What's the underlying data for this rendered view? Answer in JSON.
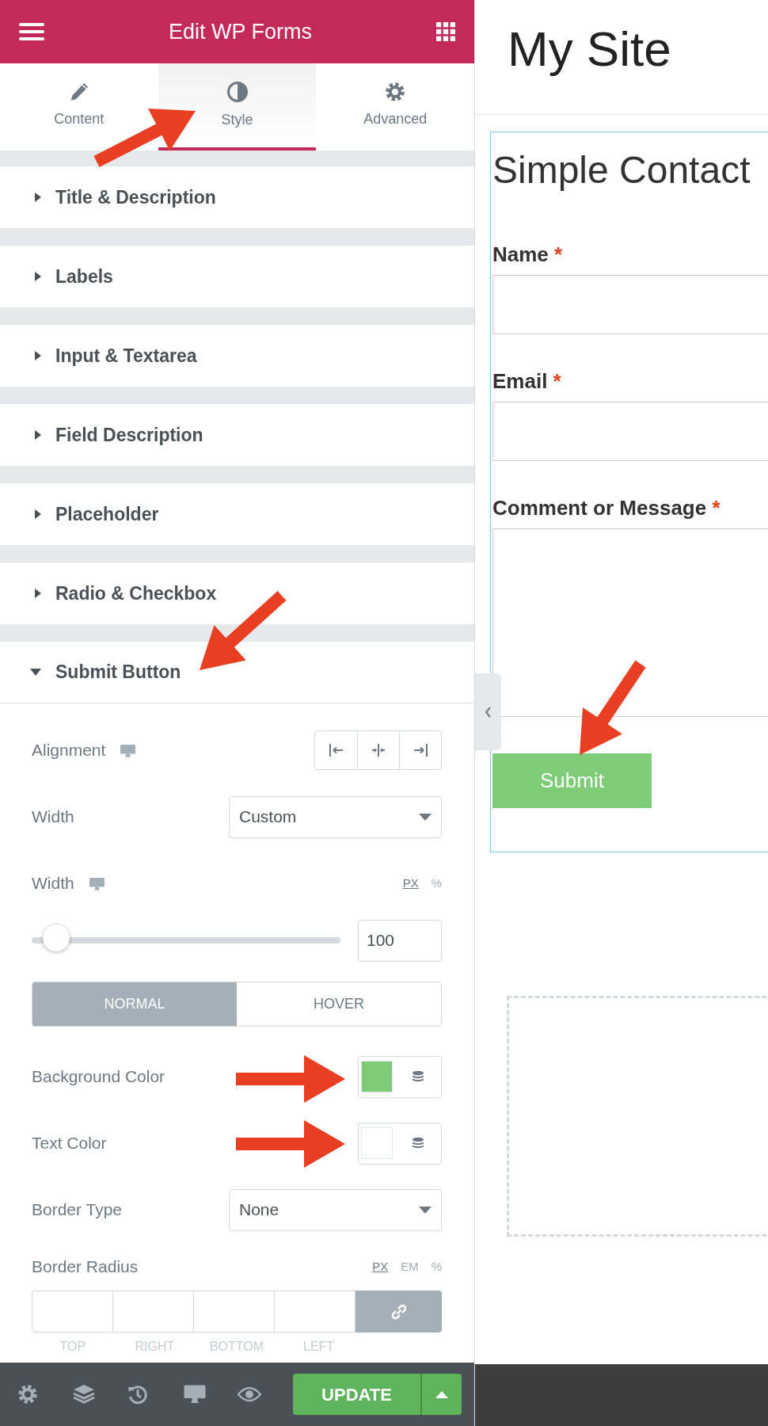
{
  "panel": {
    "title": "Edit WP Forms",
    "tabs": [
      {
        "label": "Content",
        "selected": false
      },
      {
        "label": "Style",
        "selected": true
      },
      {
        "label": "Advanced",
        "selected": false
      }
    ],
    "sections": [
      {
        "title": "Title & Description",
        "expanded": false
      },
      {
        "title": "Labels",
        "expanded": false
      },
      {
        "title": "Input & Textarea",
        "expanded": false
      },
      {
        "title": "Field Description",
        "expanded": false
      },
      {
        "title": "Placeholder",
        "expanded": false
      },
      {
        "title": "Radio & Checkbox",
        "expanded": false
      },
      {
        "title": "Submit Button",
        "expanded": true
      }
    ],
    "controls": [
      {
        "kind": "align",
        "label": "Alignment",
        "responsive": true
      },
      {
        "kind": "select",
        "label": "Width",
        "value": "Custom"
      },
      {
        "kind": "slider",
        "label": "Width",
        "responsive": true,
        "units": [
          {
            "label": "PX",
            "selected": true
          },
          {
            "label": "%",
            "selected": false
          }
        ],
        "level": 0.08,
        "value": "100"
      },
      {
        "kind": "toggle",
        "options": [
          {
            "label": "NORMAL",
            "selected": true
          },
          {
            "label": "HOVER",
            "selected": false
          }
        ]
      },
      {
        "kind": "color",
        "label": "Background Color",
        "color": "#7ecb78"
      },
      {
        "kind": "color",
        "label": "Text Color",
        "color": "#ffffff"
      },
      {
        "kind": "select",
        "label": "Border Type",
        "value": "None"
      },
      {
        "kind": "dimensions",
        "label": "Border Radius",
        "units": [
          {
            "label": "PX",
            "selected": true
          },
          {
            "label": "EM",
            "selected": false
          },
          {
            "label": "%",
            "selected": false
          }
        ],
        "sides": [
          "TOP",
          "RIGHT",
          "BOTTOM",
          "LEFT"
        ],
        "linked": true
      }
    ],
    "footer": {
      "update": "UPDATE"
    }
  },
  "preview": {
    "site_title": "My Site",
    "form_title": "Simple Contact",
    "fields": [
      {
        "kind": "input",
        "label": "Name",
        "mark": "*"
      },
      {
        "kind": "input",
        "label": "Email",
        "mark": "*"
      },
      {
        "kind": "textarea",
        "label": "Comment or Message",
        "mark": "*"
      }
    ],
    "submit": "Submit"
  }
}
